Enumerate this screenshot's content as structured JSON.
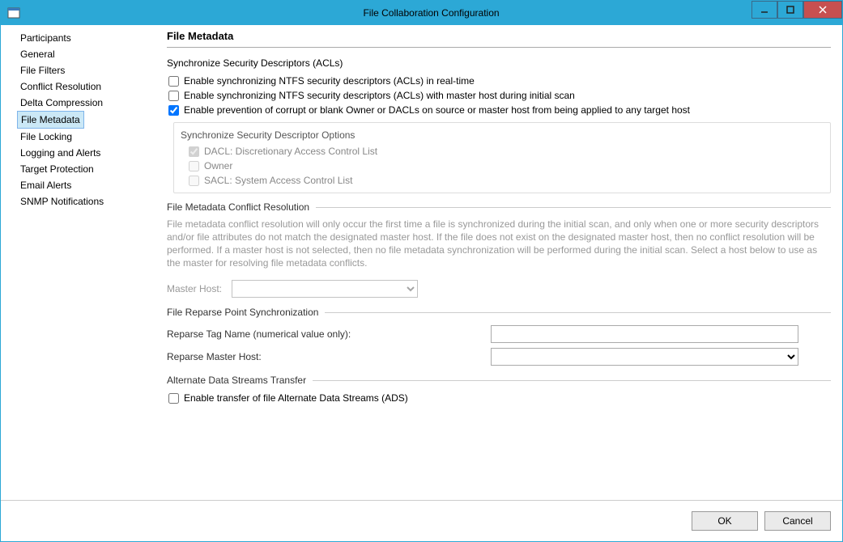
{
  "window": {
    "title": "File Collaboration Configuration"
  },
  "sidebar": {
    "items": [
      "Participants",
      "General",
      "File Filters",
      "Conflict Resolution",
      "Delta Compression",
      "File Metadata",
      "File Locking",
      "Logging and Alerts",
      "Target Protection",
      "Email Alerts",
      "SNMP Notifications"
    ],
    "selected_index": 5
  },
  "main": {
    "title": "File Metadata",
    "acl_group": {
      "title": "Synchronize Security Descriptors (ACLs)",
      "cb1": {
        "label": "Enable synchronizing NTFS security descriptors (ACLs) in real-time",
        "checked": false
      },
      "cb2": {
        "label": "Enable synchronizing NTFS security descriptors (ACLs) with master host during initial scan",
        "checked": false
      },
      "cb3": {
        "label": "Enable prevention of corrupt or blank Owner or DACLs on source or master host from being applied to any target host",
        "checked": true
      },
      "sub": {
        "title": "Synchronize Security Descriptor Options",
        "dacl": {
          "label": "DACL: Discretionary Access Control List",
          "checked": true
        },
        "owner": {
          "label": "Owner",
          "checked": false
        },
        "sacl": {
          "label": "SACL: System Access Control List",
          "checked": false
        }
      }
    },
    "conflict": {
      "title": "File Metadata Conflict Resolution",
      "desc": "File metadata conflict resolution will only occur the first time a file is synchronized during the initial scan, and only when one or more security descriptors and/or file attributes do not match the designated master host. If the file does not exist on the designated master host, then no conflict resolution will be performed. If a master host is not selected, then no file metadata synchronization will be performed during the initial scan. Select a host below to use as the master for resolving file metadata conflicts.",
      "master_host_label": "Master Host:",
      "master_host_value": ""
    },
    "reparse": {
      "title": "File Reparse Point Synchronization",
      "tag_label": "Reparse Tag Name (numerical value only):",
      "tag_value": "",
      "host_label": "Reparse Master Host:",
      "host_value": ""
    },
    "ads": {
      "title": "Alternate Data Streams Transfer",
      "cb": {
        "label": "Enable transfer of file Alternate Data Streams (ADS)",
        "checked": false
      }
    }
  },
  "footer": {
    "ok": "OK",
    "cancel": "Cancel"
  }
}
